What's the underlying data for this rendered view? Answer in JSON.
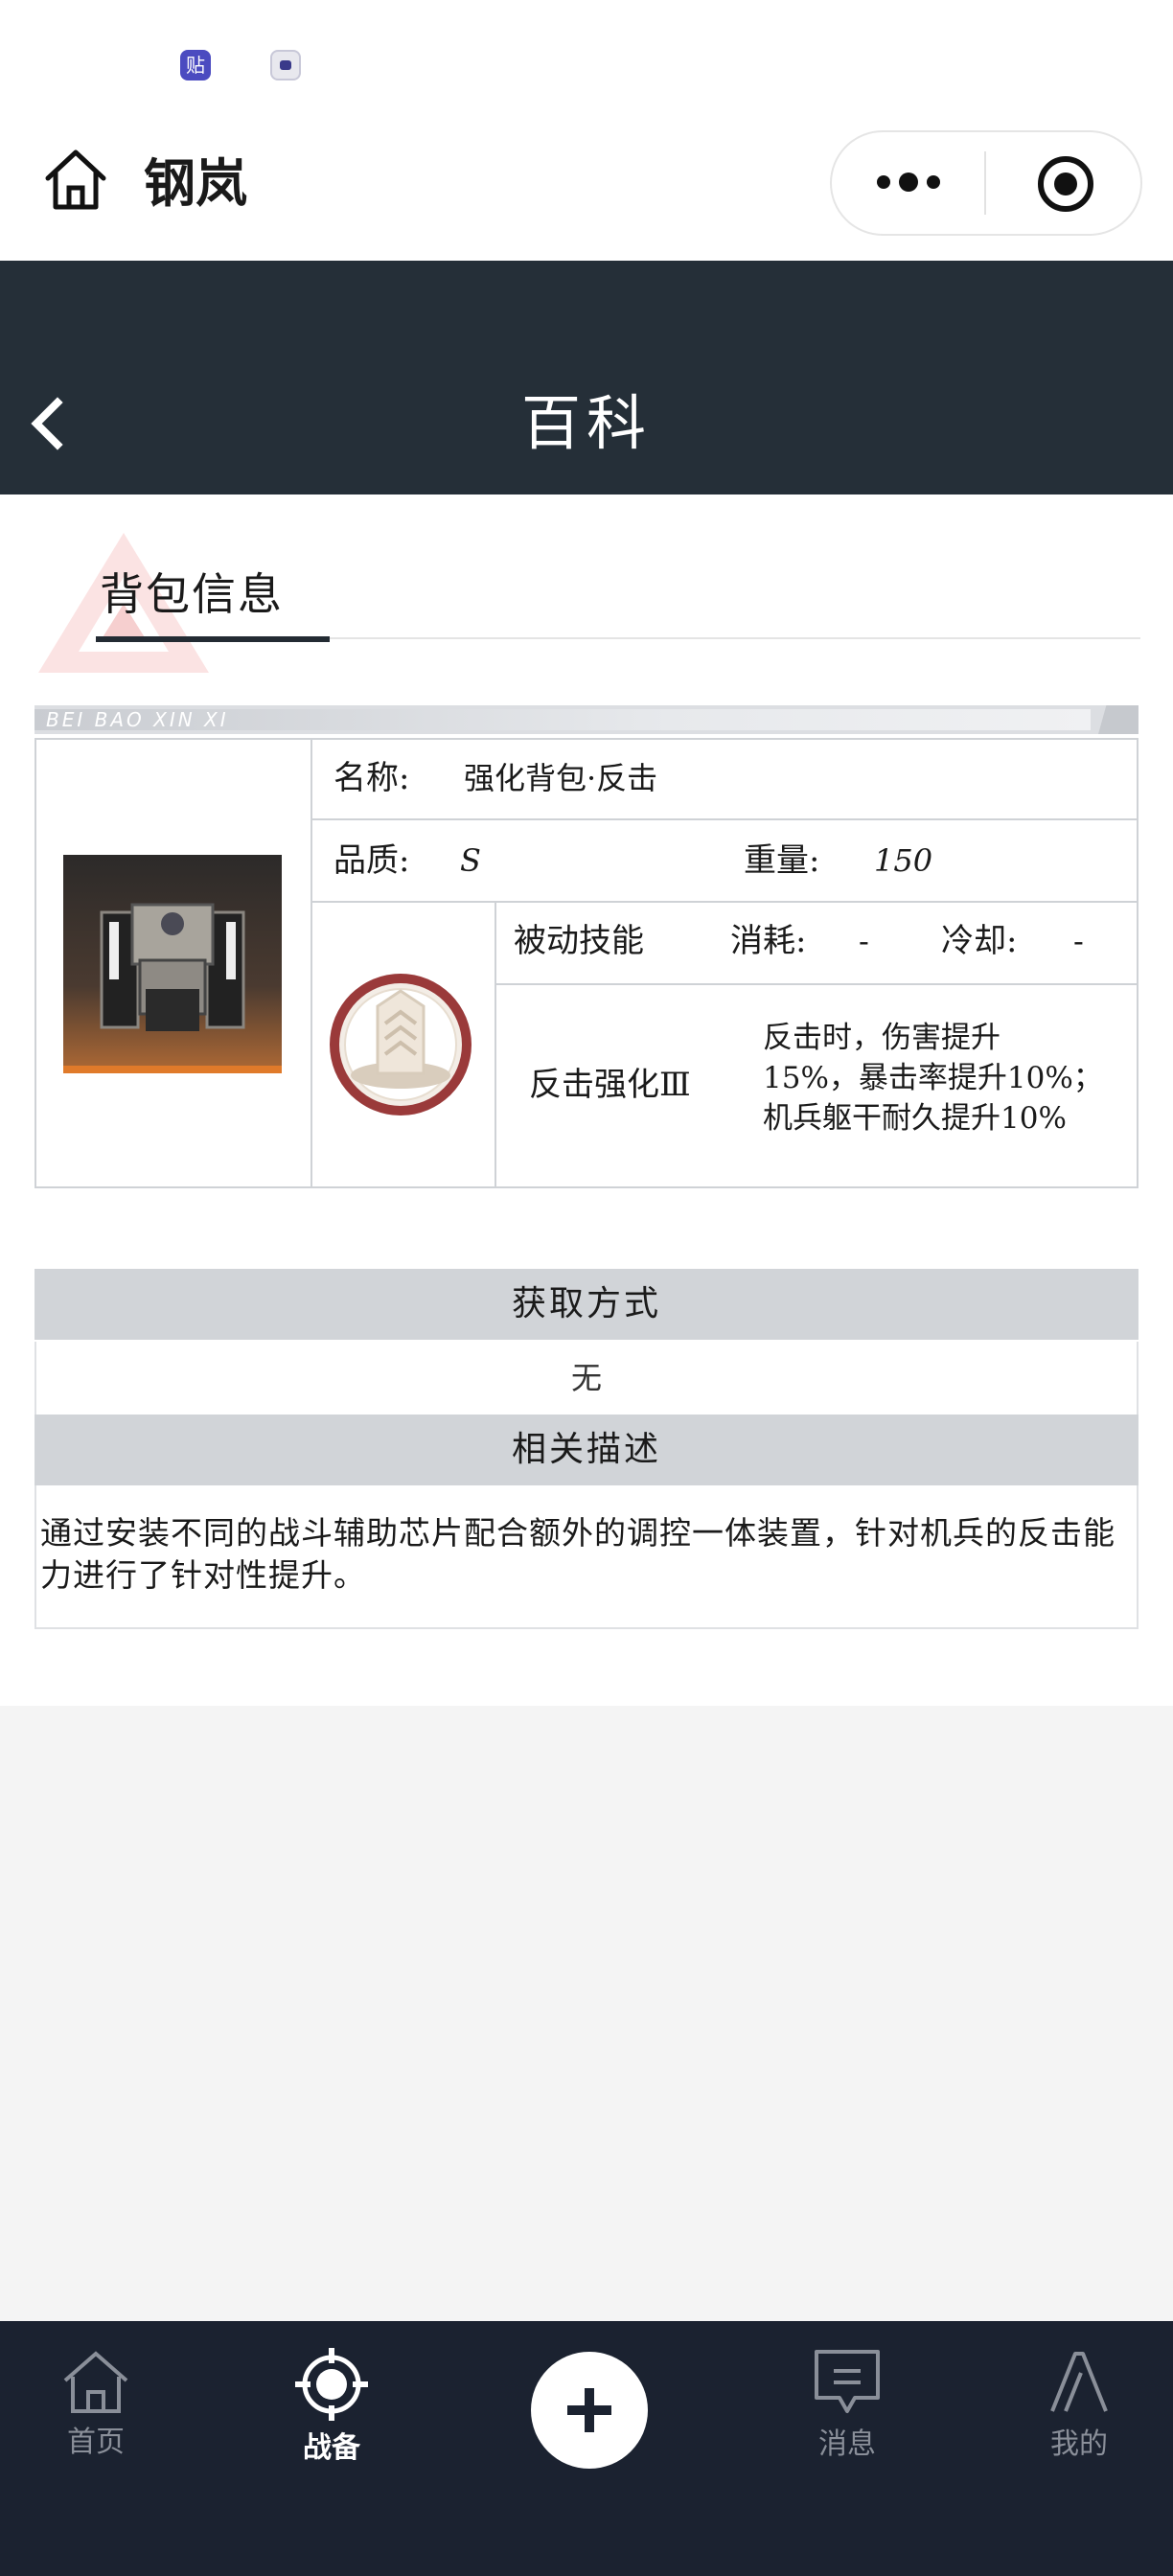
{
  "status_bar": {
    "badge1_text": "贴"
  },
  "title_bar": {
    "app_title": "钢岚",
    "icons": [
      "home-icon",
      "more-dots-icon",
      "target-icon"
    ]
  },
  "header": {
    "title": "百科",
    "back_icon": "chevron-left-icon"
  },
  "section": {
    "title": "背包信息",
    "strip_text": "BEI BAO XIN XI"
  },
  "item": {
    "name_label": "名称:",
    "name_value": "强化背包·反击",
    "quality_label": "品质:",
    "quality_value": "S",
    "weight_label": "重量:",
    "weight_value": "150",
    "skill_type": "被动技能",
    "cost_label": "消耗:",
    "cost_value": "-",
    "cooldown_label": "冷却:",
    "cooldown_value": "-",
    "skill_name": "反击强化Ⅲ",
    "skill_desc_lines": [
      "反击时，伤害提升",
      "15%，暴击率提升10%；",
      "机兵躯干耐久提升10%"
    ]
  },
  "obtain": {
    "header": "获取方式",
    "value": "无"
  },
  "description": {
    "header": "相关描述",
    "text": "通过安装不同的战斗辅助芯片配合额外的调控一体装置，针对机兵的反击能力进行了针对性提升。"
  },
  "tab_bar": {
    "tabs": [
      {
        "label": "首页",
        "icon": "home-icon",
        "active": false
      },
      {
        "label": "战备",
        "icon": "crosshair-icon",
        "active": true
      },
      {
        "label": "",
        "icon": "plus-icon",
        "active": false
      },
      {
        "label": "消息",
        "icon": "message-icon",
        "active": false
      },
      {
        "label": "我的",
        "icon": "profile-logo-icon",
        "active": false
      }
    ]
  },
  "colors": {
    "header_bg": "#252f38",
    "tabbar_bg": "#1b2230",
    "section_bar": "#d1d4d8",
    "skill_red": "#9a3a3a"
  }
}
